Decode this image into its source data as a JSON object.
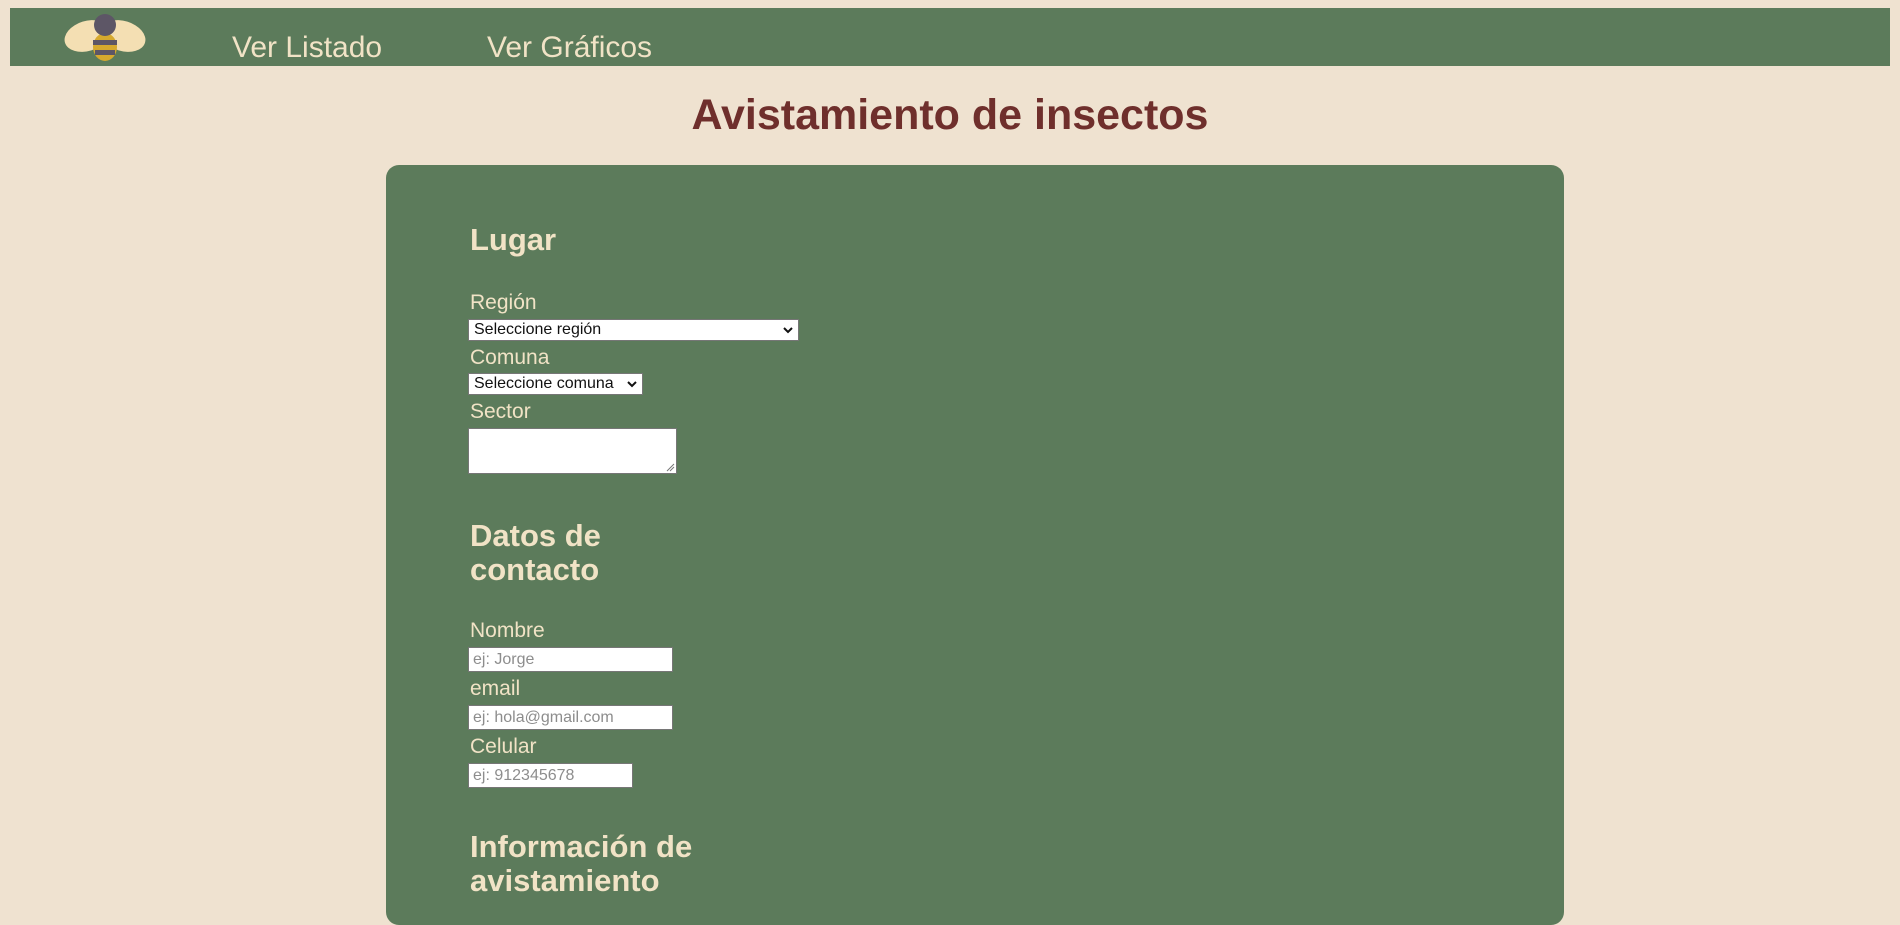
{
  "navbar": {
    "logo_icon": "bee-logo-icon",
    "links": [
      {
        "label": "Ver Listado"
      },
      {
        "label": "Ver Gráficos"
      }
    ]
  },
  "page": {
    "title": "Avistamiento de insectos"
  },
  "form": {
    "place": {
      "title": "Lugar",
      "region": {
        "label": "Región",
        "selected": "Seleccione región"
      },
      "commune": {
        "label": "Comuna",
        "selected": "Seleccione comuna"
      },
      "sector": {
        "label": "Sector",
        "value": ""
      }
    },
    "contact": {
      "title_line1": "Datos de",
      "title_line2": "contacto",
      "name": {
        "label": "Nombre",
        "placeholder": "ej: Jorge"
      },
      "email": {
        "label": "email",
        "placeholder": "ej: hola@gmail.com"
      },
      "phone": {
        "label": "Celular",
        "placeholder": "ej: 912345678"
      }
    },
    "sighting": {
      "title_line1": "Información de",
      "title_line2": "avistamiento"
    }
  },
  "colors": {
    "background": "#efe2d0",
    "green_panel": "#5c7b5b",
    "cream_text": "#f1e3c6",
    "title_red": "#6f2f2c"
  }
}
